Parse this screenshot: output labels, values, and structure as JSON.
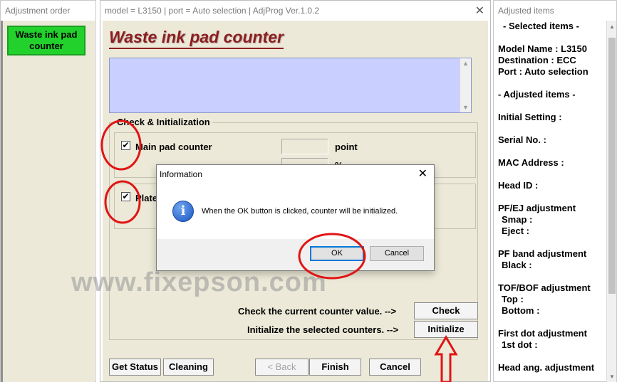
{
  "left_window": {
    "title": "Adjustment order",
    "item_label": "Waste ink pad counter"
  },
  "main_window": {
    "title": "model = L3150 | port = Auto selection | AdjProg Ver.1.0.2",
    "heading": "Waste ink pad counter",
    "group_label": "Check & Initialization",
    "main_pad_label": "Main pad counter",
    "main_pad_unit_point": "point",
    "main_pad_unit_percent": "%",
    "platen_pad_label": "Platen pad counter",
    "check_text": "Check the current counter value. -->",
    "check_button": "Check",
    "init_text": "Initialize the selected counters. -->",
    "init_button": "Initialize",
    "bottom_buttons": {
      "get_status": "Get Status",
      "cleaning": "Cleaning",
      "back": "< Back",
      "finish": "Finish",
      "cancel": "Cancel"
    },
    "watermark": "www.fixepson.com"
  },
  "right_window": {
    "title": "Adjusted items",
    "lines": [
      "- Selected items -",
      "Model Name : L3150",
      "Destination : ECC",
      "Port : Auto selection",
      "- Adjusted items -",
      "Initial Setting :",
      "Serial No. :",
      "MAC Address :",
      "Head ID :",
      "PF/EJ adjustment",
      "Smap :",
      "Eject :",
      "PF band adjustment",
      "Black :",
      "TOF/BOF adjustment",
      "Top :",
      "Bottom :",
      "First dot adjustment",
      "1st dot :",
      "Head ang. adjustment"
    ]
  },
  "dialog": {
    "title": "Information",
    "message": "When the OK button is clicked, counter will be initialized.",
    "ok_label": "OK",
    "cancel_label": "Cancel",
    "icon": "info-icon"
  },
  "colors": {
    "panel": "#ece9d8",
    "heading_red": "#8b1f1f",
    "message_area": "#c9d0ff",
    "side_button_green": "#22d12c",
    "annotation_red": "#e01515"
  }
}
